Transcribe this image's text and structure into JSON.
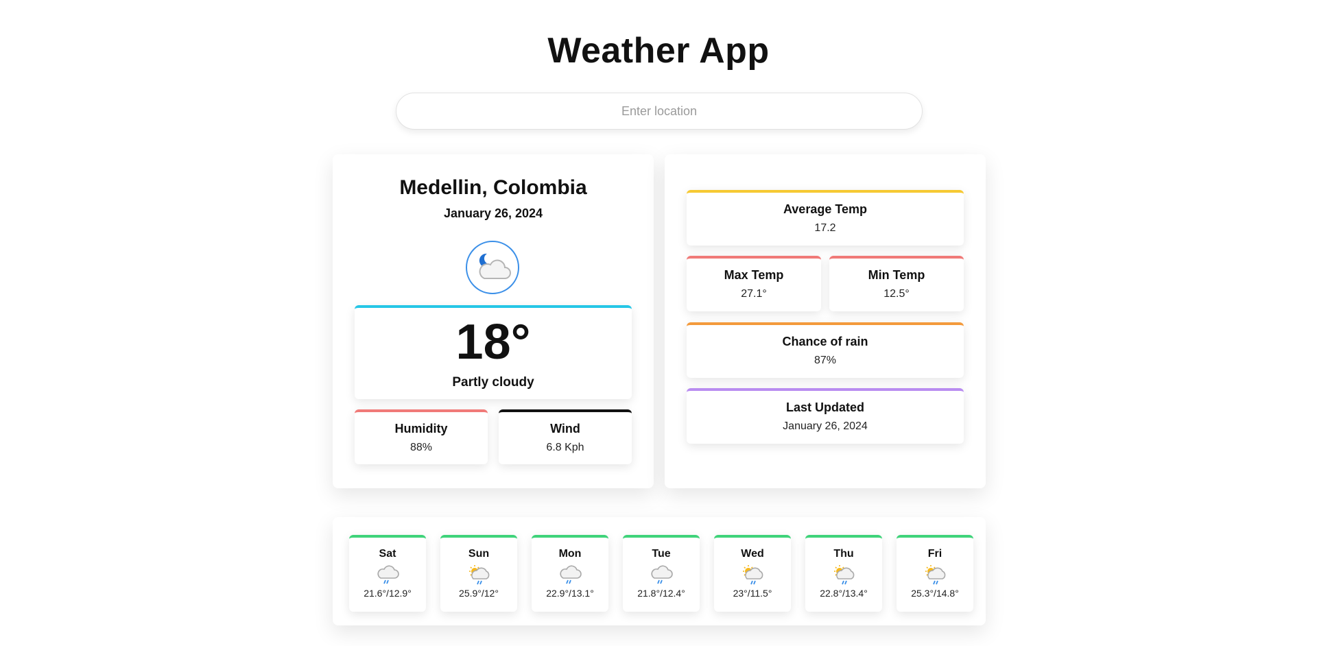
{
  "app": {
    "title": "Weather App"
  },
  "search": {
    "placeholder": "Enter location"
  },
  "current": {
    "location": "Medellin, Colombia",
    "date": "January 26, 2024",
    "temperature": "18°",
    "condition": "Partly cloudy",
    "condition_icon": "night-cloud-icon",
    "humidity": {
      "label": "Humidity",
      "value": "88%"
    },
    "wind": {
      "label": "Wind",
      "value": "6.8 Kph"
    }
  },
  "stats": {
    "average": {
      "label": "Average Temp",
      "value": "17.2"
    },
    "max": {
      "label": "Max Temp",
      "value": "27.1°"
    },
    "min": {
      "label": "Min Temp",
      "value": "12.5°"
    },
    "rain": {
      "label": "Chance of rain",
      "value": "87%"
    },
    "updated": {
      "label": "Last Updated",
      "value": "January 26, 2024"
    }
  },
  "forecast": [
    {
      "day": "Sat",
      "range": "21.6°/12.9°",
      "icon": "rain-cloud-icon"
    },
    {
      "day": "Sun",
      "range": "25.9°/12°",
      "icon": "sun-rain-cloud-icon"
    },
    {
      "day": "Mon",
      "range": "22.9°/13.1°",
      "icon": "rain-cloud-icon"
    },
    {
      "day": "Tue",
      "range": "21.8°/12.4°",
      "icon": "rain-cloud-icon"
    },
    {
      "day": "Wed",
      "range": "23°/11.5°",
      "icon": "sun-rain-cloud-icon"
    },
    {
      "day": "Thu",
      "range": "22.8°/13.4°",
      "icon": "sun-rain-cloud-icon"
    },
    {
      "day": "Fri",
      "range": "25.3°/14.8°",
      "icon": "sun-rain-cloud-icon"
    }
  ],
  "colors": {
    "temp_accent": "#26c6e6",
    "humidity_accent": "#f07a78",
    "wind_accent": "#111111",
    "average_accent": "#f6c933",
    "max_min_accent": "#f07a78",
    "rain_accent": "#f39a3c",
    "updated_accent": "#b98cf0",
    "forecast_accent": "#3fd37a",
    "icon_ring": "#3a8fe8"
  }
}
